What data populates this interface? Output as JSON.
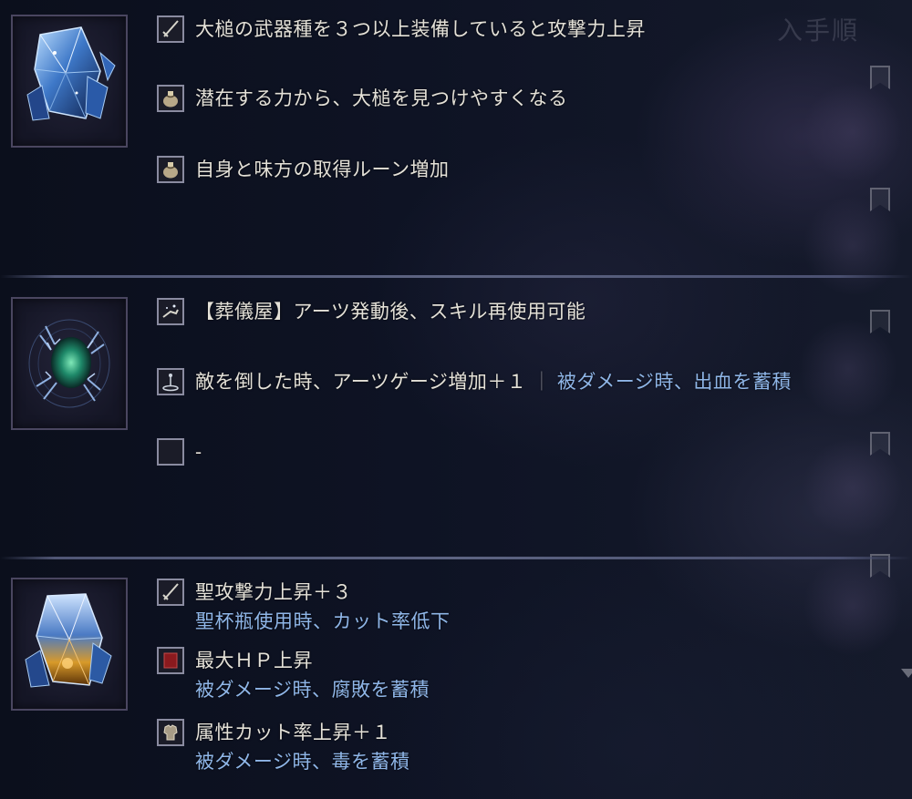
{
  "background_heading": "入手順",
  "relics": [
    {
      "image": "blue-crystal-relic",
      "effects": [
        {
          "icon": "sword-icon",
          "text": "大槌の武器種を３つ以上装備していると攻撃力上昇"
        },
        {
          "icon": "pouch-icon",
          "text": "潜在する力から、大槌を見つけやすくなる"
        },
        {
          "icon": "pouch-icon",
          "text": "自身と味方の取得ルーン増加"
        }
      ]
    },
    {
      "image": "green-orb-relic",
      "effects": [
        {
          "icon": "hand-sparkle-icon",
          "text": "【葬儀屋】アーツ発動後、スキル再使用可能"
        },
        {
          "icon": "pedestal-icon",
          "text": "敵を倒した時、アーツゲージ増加＋１",
          "separator": "｜",
          "debuff": "被ダメージ時、出血を蓄積"
        },
        {
          "icon": "empty-slot-icon",
          "text": "-"
        }
      ]
    },
    {
      "image": "amber-crystal-relic",
      "effects": [
        {
          "icon": "sword-icon",
          "text": "聖攻撃力上昇＋３",
          "debuff": "聖杯瓶使用時、カット率低下"
        },
        {
          "icon": "red-square-icon",
          "text": "最大ＨＰ上昇",
          "debuff": "被ダメージ時、腐敗を蓄積"
        },
        {
          "icon": "armor-icon",
          "text": "属性カット率上昇＋１",
          "debuff": "被ダメージ時、毒を蓄積"
        }
      ]
    }
  ],
  "colors": {
    "effect_text": "#e4e1d8",
    "debuff_text": "#8fb6e8",
    "frame": "#4a4660",
    "background": "#0d1120"
  }
}
